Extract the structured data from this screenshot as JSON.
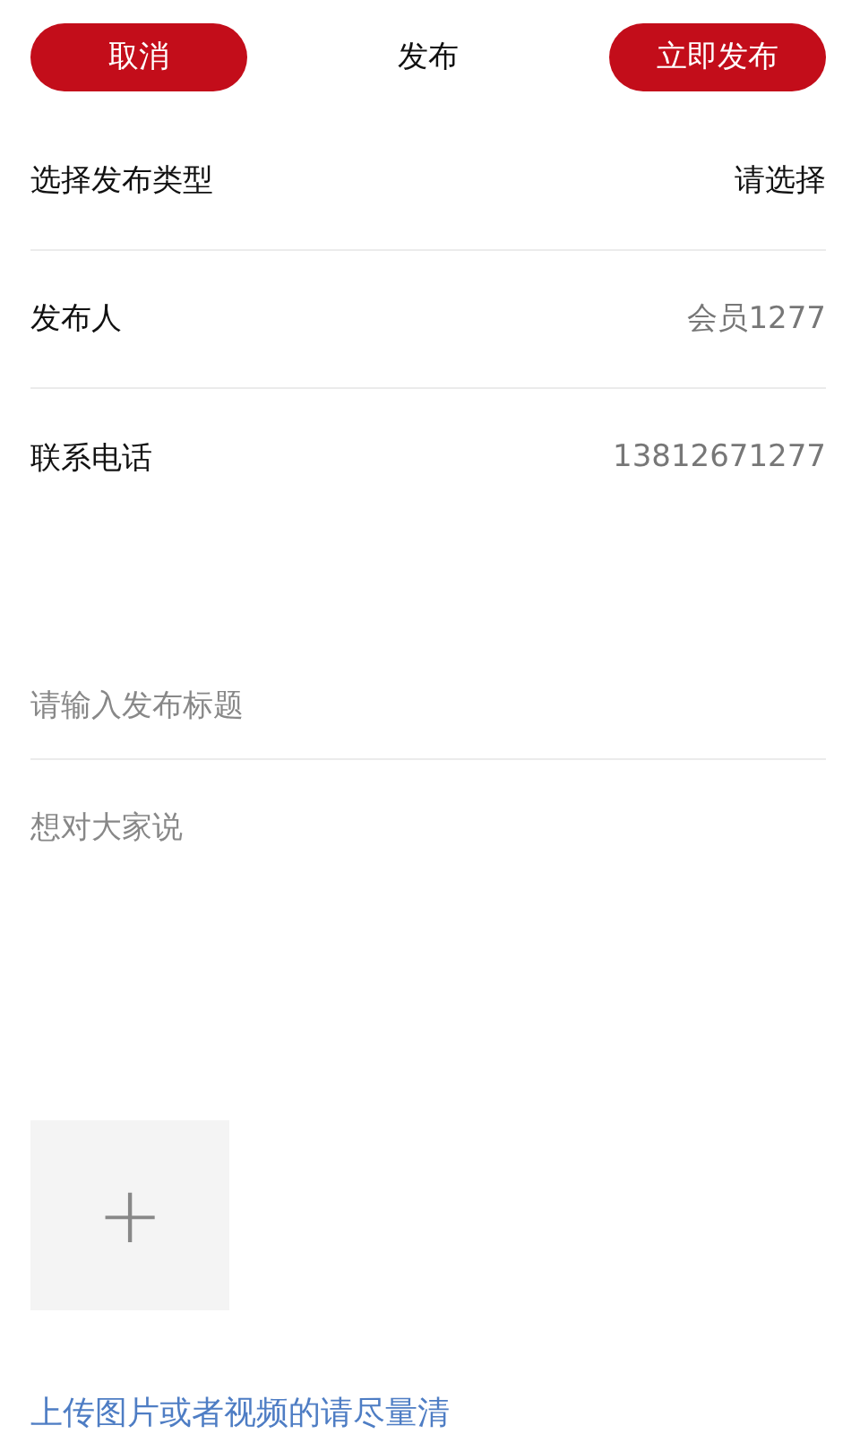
{
  "header": {
    "cancel": "取消",
    "title": "发布",
    "publish": "立即发布"
  },
  "rows": [
    {
      "label": "选择发布类型",
      "value": "请选择",
      "kind": "select"
    },
    {
      "label": "发布人",
      "value": "会员1277",
      "kind": "info"
    },
    {
      "label": "联系电话",
      "value": "13812671277",
      "kind": "info"
    }
  ],
  "title_field": {
    "placeholder": "请输入发布标题"
  },
  "content_field": {
    "placeholder": "想对大家说"
  },
  "upload": {
    "icon": "+"
  },
  "hint": "上传图片或者视频的请尽量清"
}
